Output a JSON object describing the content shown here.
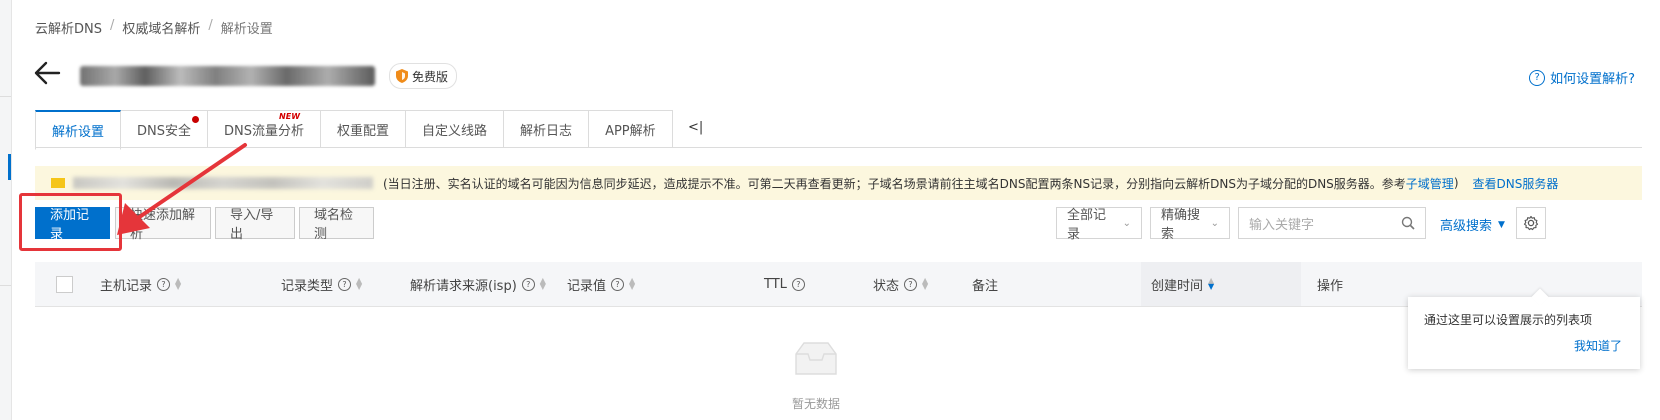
{
  "breadcrumb": [
    "云解析DNS",
    "权威域名解析",
    "解析设置"
  ],
  "breadcrumb_sep": "/",
  "plan_badge": "免费版",
  "help_link": "如何设置解析?",
  "tabs": [
    {
      "label": "解析设置",
      "active": true
    },
    {
      "label": "DNS安全",
      "dot": true
    },
    {
      "label": "DNS流量分析",
      "new": "NEW"
    },
    {
      "label": "权重配置"
    },
    {
      "label": "自定义线路"
    },
    {
      "label": "解析日志"
    },
    {
      "label": "APP解析"
    }
  ],
  "tab_collapse": "<|",
  "notice": {
    "text": "(当日注册、实名认证的域名可能因为信息同步延迟，造成提示不准。可第二天再查看更新；子域名场景请前往主域名DNS配置两条NS记录，分别指向云解析DNS为子域分配的DNS服务器。参考",
    "link1": "子域管理",
    "close_paren": ")",
    "link2": "查看DNS服务器"
  },
  "toolbar": {
    "add": "添加记录",
    "quick_add": "快速添加解析",
    "import_export": "导入/导出",
    "check": "域名检测",
    "filter_all": "全部记录",
    "search_mode": "精确搜索",
    "search_placeholder": "输入关键字",
    "advanced": "高级搜索"
  },
  "columns": {
    "host": "主机记录",
    "type": "记录类型",
    "isp": "解析请求来源(isp)",
    "value": "记录值",
    "ttl": "TTL",
    "status": "状态",
    "remark": "备注",
    "created": "创建时间",
    "action": "操作"
  },
  "tooltip": {
    "text": "通过这里可以设置展示的列表项",
    "ok": "我知道了"
  },
  "empty": "暂无数据",
  "colors": {
    "primary": "#0070cc",
    "highlight": "#e5353a",
    "notice_bg": "#fcf7de"
  }
}
